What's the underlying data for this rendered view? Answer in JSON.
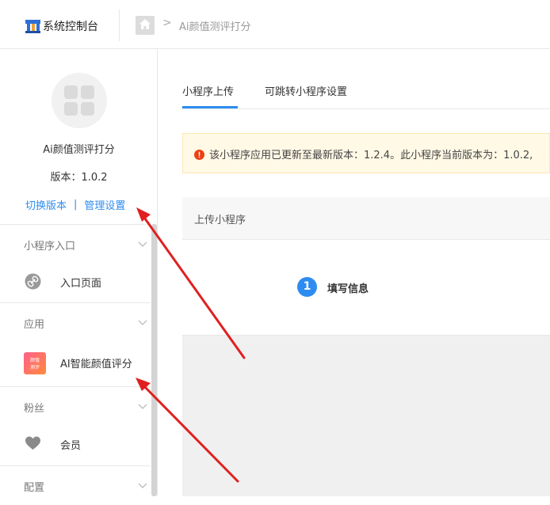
{
  "header": {
    "brand_title": "系统控制台",
    "breadcrumb": {
      "current": "Ai颜值测评打分",
      "separator": ">"
    }
  },
  "sidebar": {
    "app_name": "Ai颜值测评打分",
    "app_version": "版本：1.0.2",
    "links": {
      "switch_version": "切换版本",
      "separator": "|",
      "manage_settings": "管理设置"
    },
    "sections": [
      {
        "label": "小程序入口",
        "items": [
          {
            "label": "入口页面",
            "icon": "link-icon"
          }
        ]
      },
      {
        "label": "应用",
        "items": [
          {
            "label": "AI智能颜值评分",
            "icon": "beauty-score-app-icon",
            "icon_text": "颜值测评"
          }
        ]
      },
      {
        "label": "粉丝",
        "items": [
          {
            "label": "会员",
            "icon": "heart-icon"
          }
        ]
      },
      {
        "label": "配置",
        "items": []
      }
    ]
  },
  "main": {
    "tabs": [
      {
        "label": "小程序上传",
        "active": true
      },
      {
        "label": "可跳转小程序设置",
        "active": false
      }
    ],
    "alert": {
      "text": "该小程序应用已更新至最新版本：1.2.4。此小程序当前版本为：1.0.2,",
      "icon": "exclamation-circle-icon"
    },
    "upload_card": {
      "title": "上传小程序",
      "step": {
        "number": "1",
        "label": "填写信息"
      }
    }
  },
  "colors": {
    "accent": "#2d8cf0",
    "alert_bg": "#fff9e6",
    "alert_icon": "#ed4014",
    "annotation_arrow": "#e02020"
  }
}
